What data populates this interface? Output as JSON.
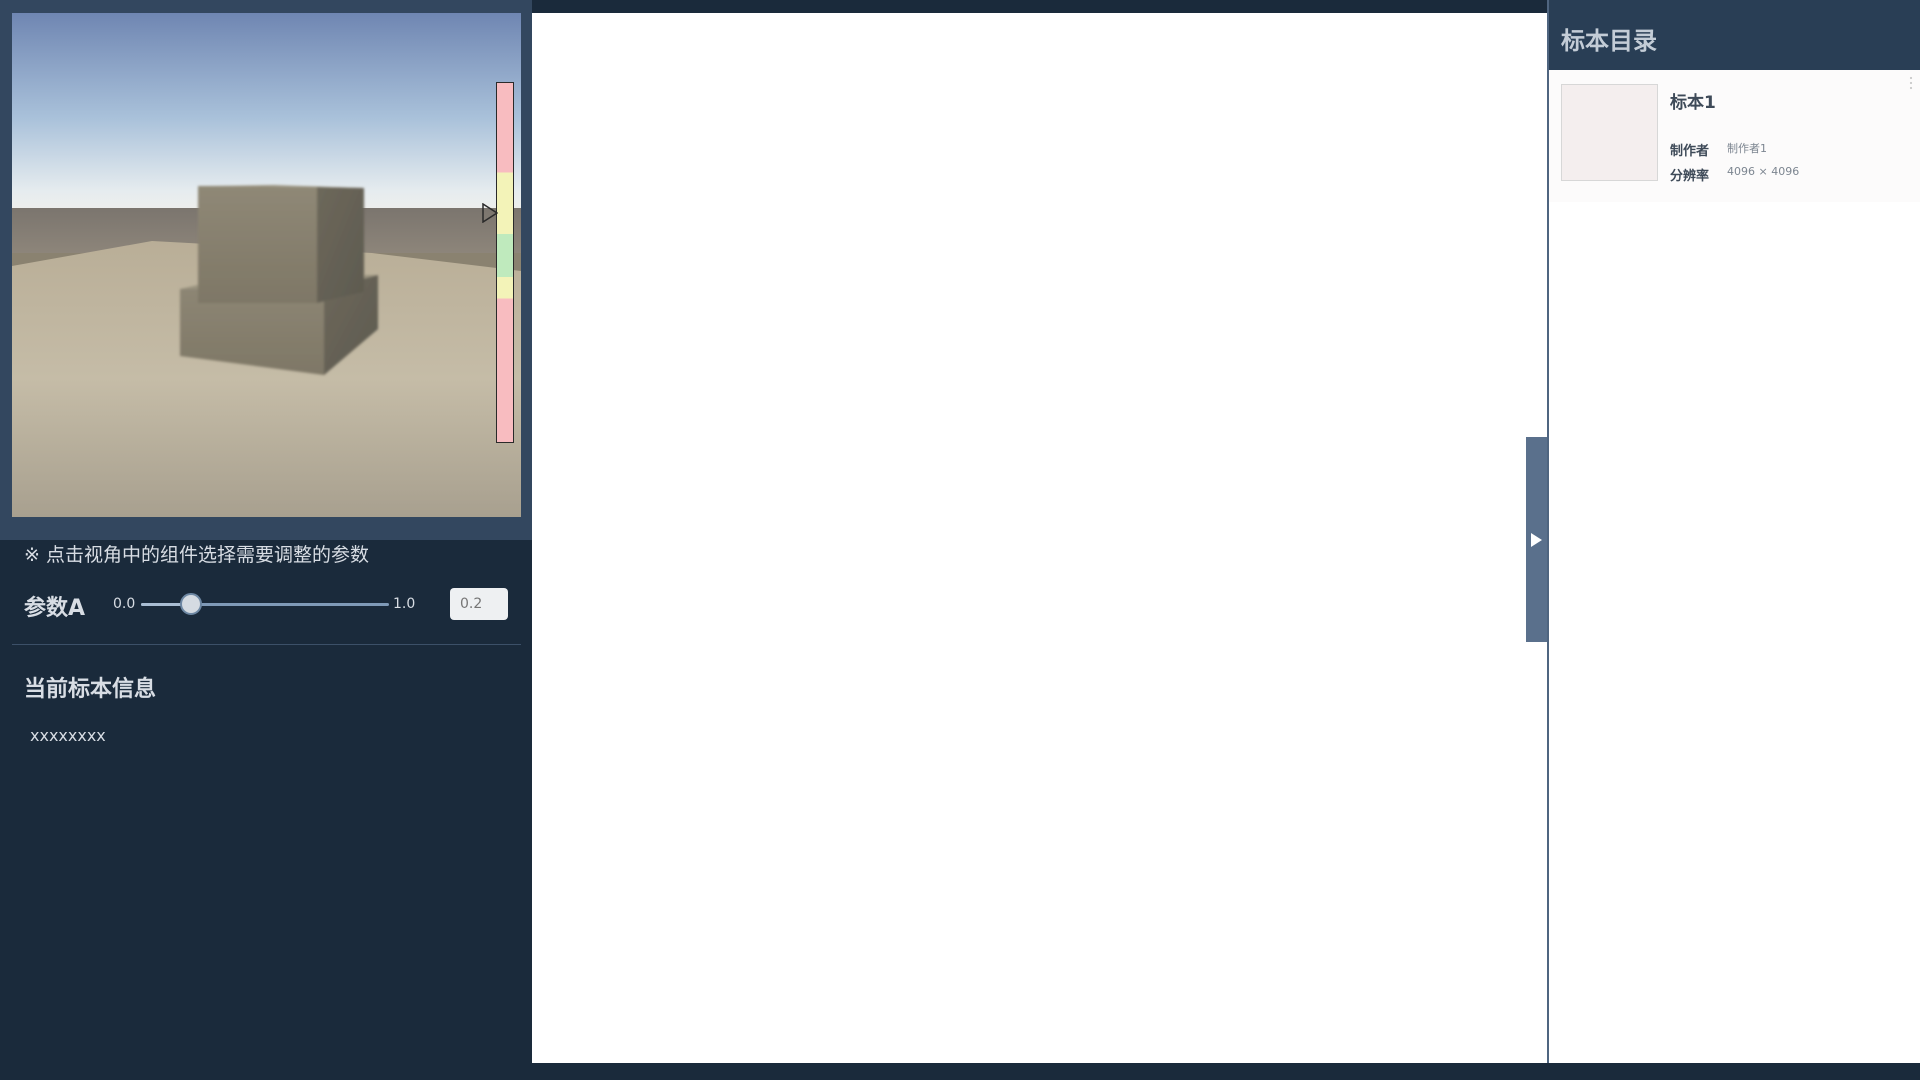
{
  "viewport": {
    "scene": "3d-preview",
    "gauge_marker_icon": "triangle-pointer-icon"
  },
  "hint_text": "※ 点击视角中的组件选择需要调整的参数",
  "parameter": {
    "label": "参数A",
    "min_label": "0.0",
    "max_label": "1.0",
    "value": 0.2,
    "input_placeholder": "0.2"
  },
  "info": {
    "title": "当前标本信息",
    "text": "xxxxxxxx"
  },
  "catalog": {
    "title": "标本目录",
    "items": [
      {
        "name": "标本1",
        "author_label": "制作者",
        "author_value": "制作者1",
        "resolution_label": "分辨率",
        "resolution_value": "4096 × 4096"
      }
    ]
  },
  "collapse_icon": "play-right-icon",
  "colors": {
    "panel_bg": "#1a2a3b",
    "catalog_header_bg": "#293e55",
    "handle_bg": "#5a708c"
  }
}
